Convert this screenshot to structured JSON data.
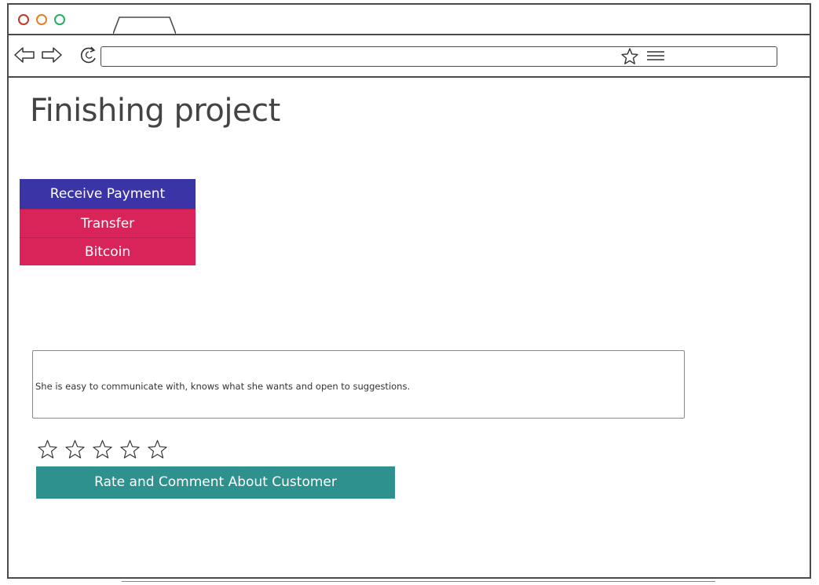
{
  "page": {
    "title": "Finishing project"
  },
  "payment_options": {
    "receive_payment": "Receive Payment",
    "transfer": "Transfer",
    "bitcoin": "Bitcoin"
  },
  "comment": {
    "value": "She is easy to communicate with, knows what she wants and open to suggestions."
  },
  "rating": {
    "max": 5,
    "value": 0
  },
  "actions": {
    "rate_label": "Rate and Comment About Customer"
  },
  "colors": {
    "receive_payment_bg": "#3a34a6",
    "payment_option_bg": "#d9245a",
    "rate_button_bg": "#2e918e",
    "window_close": "#c0392b",
    "window_minimize": "#e67e22",
    "window_maximize": "#27ae60"
  }
}
